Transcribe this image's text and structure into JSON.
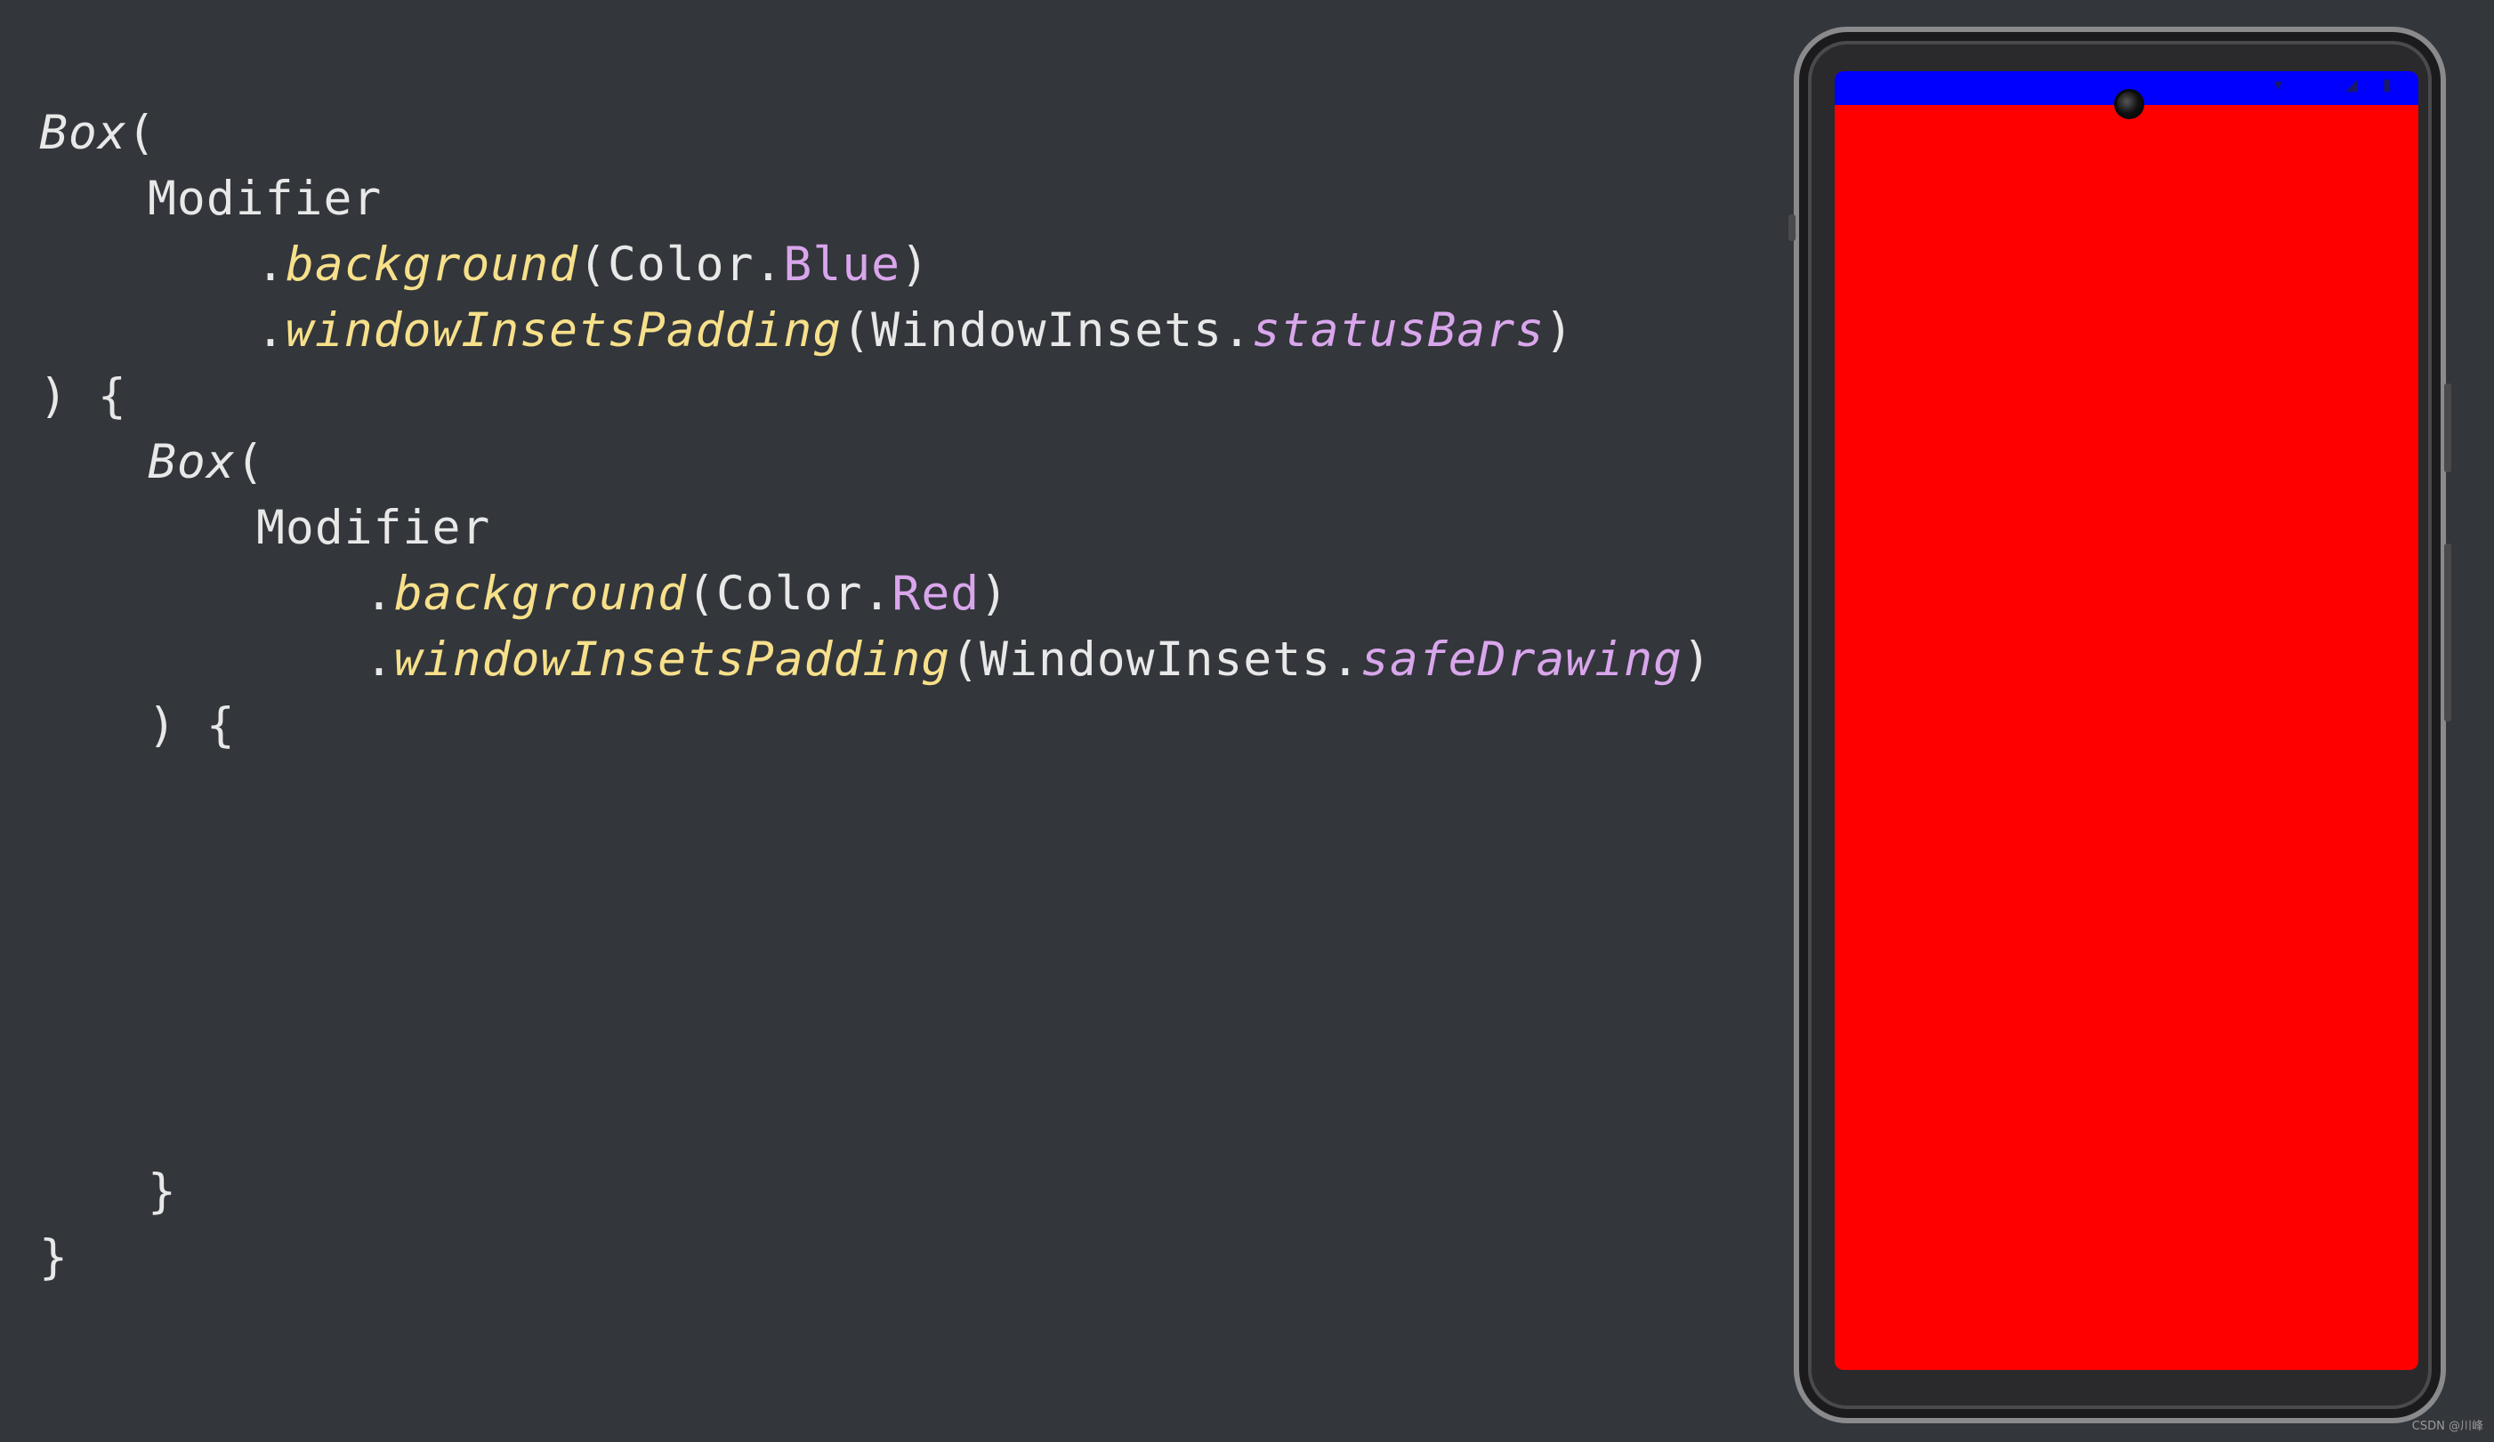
{
  "code": {
    "l1": {
      "box": "Box",
      "open": "("
    },
    "l2": {
      "modifier": "Modifier"
    },
    "l3": {
      "dot": ".",
      "fn": "background",
      "open": "(",
      "color": "Color",
      "dot2": ".",
      "value": "Blue",
      "close": ")"
    },
    "l4": {
      "dot": ".",
      "fn": "windowInsetsPadding",
      "open": "(",
      "insets": "WindowInsets",
      "dot2": ".",
      "value": "statusBars",
      "close": ")"
    },
    "l5": {
      "text": ") {"
    },
    "l6": {
      "box": "Box",
      "open": "("
    },
    "l7": {
      "modifier": "Modifier"
    },
    "l8": {
      "dot": ".",
      "fn": "background",
      "open": "(",
      "color": "Color",
      "dot2": ".",
      "value": "Red",
      "close": ")"
    },
    "l9": {
      "dot": ".",
      "fn": "windowInsetsPadding",
      "open": "(",
      "insets": "WindowInsets",
      "dot2": ".",
      "value": "safeDrawing",
      "close": ")"
    },
    "l10": {
      "text": ") {"
    },
    "l11": {
      "text": "}"
    },
    "l12": {
      "text": "}"
    }
  },
  "phone": {
    "status_bar_color": "#0000ff",
    "content_color": "#ff0000",
    "status_icons": [
      "wifi-icon",
      "signal-icon",
      "battery-icon"
    ]
  },
  "watermark": "CSDN @川峰",
  "colors": {
    "background": "#33363b",
    "function": "#f7e08a",
    "property": "#d9a6ec",
    "text": "#e8e8e8"
  }
}
